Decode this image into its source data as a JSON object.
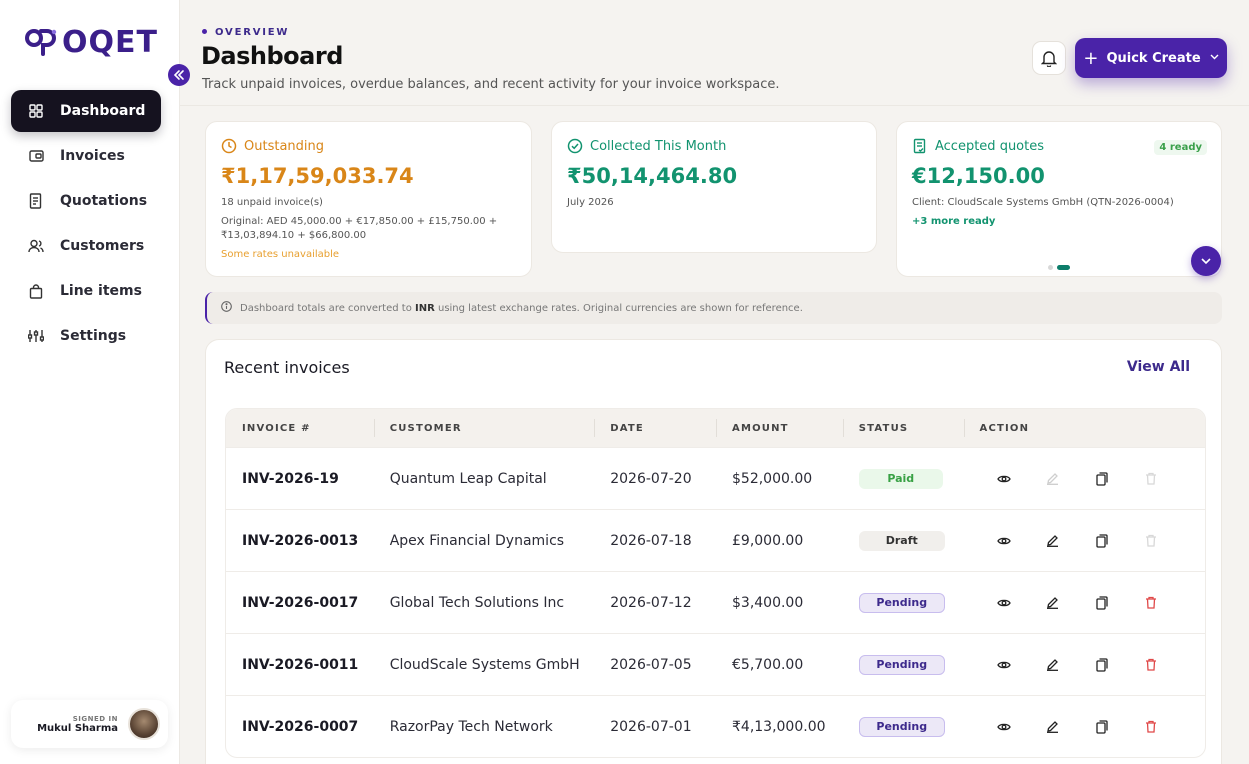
{
  "brand": {
    "name": "OQET",
    "accent": "#4a23a8"
  },
  "sidebar": {
    "items": [
      {
        "label": "Dashboard",
        "icon": "grid-icon",
        "active": true
      },
      {
        "label": "Invoices",
        "icon": "wallet-icon",
        "active": false
      },
      {
        "label": "Quotations",
        "icon": "document-icon",
        "active": false
      },
      {
        "label": "Customers",
        "icon": "users-icon",
        "active": false
      },
      {
        "label": "Line items",
        "icon": "bag-icon",
        "active": false
      },
      {
        "label": "Settings",
        "icon": "sliders-icon",
        "active": false
      }
    ],
    "signed_in_label": "SIGNED IN",
    "user_name": "Mukul Sharma"
  },
  "header": {
    "eyebrow": "OVERVIEW",
    "title": "Dashboard",
    "subtitle": "Track unpaid invoices, overdue balances, and recent activity for your invoice workspace.",
    "quick_create": "Quick Create"
  },
  "cards": {
    "outstanding": {
      "title": "Outstanding",
      "value": "₹1,17,59,033.74",
      "count": "18 unpaid invoice(s)",
      "original": "Original: AED 45,000.00 + €17,850.00 + £15,750.00 + ₹13,03,894.10 + $66,800.00",
      "warning": "Some rates unavailable",
      "color": "#d98618"
    },
    "collected": {
      "title": "Collected This Month",
      "value": "₹50,14,464.80",
      "period": "July 2026",
      "color": "#12936f"
    },
    "accepted": {
      "title": "Accepted quotes",
      "badge": "4 ready",
      "value": "€12,150.00",
      "client": "Client: CloudScale Systems GmbH (QTN-2026-0004)",
      "more": "+3 more ready",
      "color": "#12936f"
    }
  },
  "info": {
    "prefix": "Dashboard totals are converted to ",
    "currency": "INR",
    "suffix": " using latest exchange rates. Original currencies are shown for reference."
  },
  "recent": {
    "title": "Recent invoices",
    "view_all": "View All",
    "columns": [
      "INVOICE #",
      "CUSTOMER",
      "DATE",
      "AMOUNT",
      "STATUS",
      "ACTION"
    ],
    "rows": [
      {
        "invoice": "INV-2026-19",
        "customer": "Quantum Leap Capital",
        "date": "2026-07-20",
        "amount": "$52,000.00",
        "status": "Paid"
      },
      {
        "invoice": "INV-2026-0013",
        "customer": "Apex Financial Dynamics",
        "date": "2026-07-18",
        "amount": "£9,000.00",
        "status": "Draft"
      },
      {
        "invoice": "INV-2026-0017",
        "customer": "Global Tech Solutions Inc",
        "date": "2026-07-12",
        "amount": "$3,400.00",
        "status": "Pending"
      },
      {
        "invoice": "INV-2026-0011",
        "customer": "CloudScale Systems GmbH",
        "date": "2026-07-05",
        "amount": "€5,700.00",
        "status": "Pending"
      },
      {
        "invoice": "INV-2026-0007",
        "customer": "RazorPay Tech Network",
        "date": "2026-07-01",
        "amount": "₹4,13,000.00",
        "status": "Pending"
      }
    ]
  }
}
